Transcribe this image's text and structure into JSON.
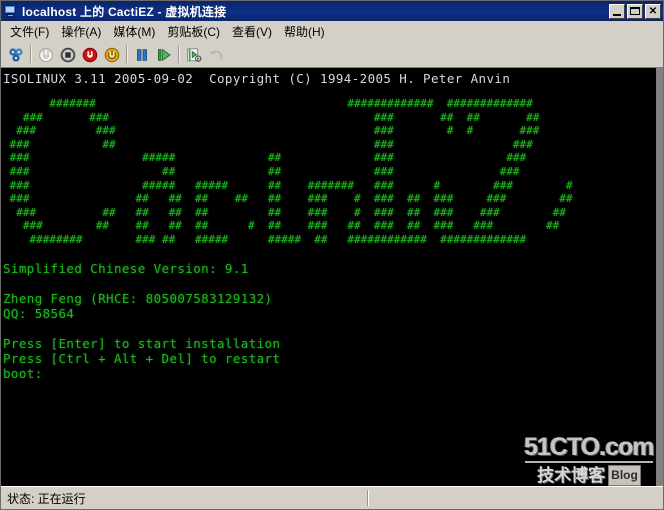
{
  "window": {
    "title": "localhost 上的 CactiEZ - 虚拟机连接",
    "title_icon": "computer-monitor-icon",
    "buttons": {
      "minimize": "minimize-button",
      "maximize": "maximize-button",
      "close": "✕"
    }
  },
  "menubar": {
    "items": [
      {
        "label": "文件(F)",
        "name": "menu-file"
      },
      {
        "label": "操作(A)",
        "name": "menu-action"
      },
      {
        "label": "媒体(M)",
        "name": "menu-media"
      },
      {
        "label": "剪贴板(C)",
        "name": "menu-clipboard"
      },
      {
        "label": "查看(V)",
        "name": "menu-view"
      },
      {
        "label": "帮助(H)",
        "name": "menu-help"
      }
    ]
  },
  "toolbar": {
    "buttons": [
      {
        "name": "ctrl-alt-delete-icon",
        "enabled": true
      },
      {
        "name": "power-off-icon",
        "enabled": false
      },
      {
        "name": "shut-down-icon",
        "enabled": true
      },
      {
        "name": "turn-off-icon",
        "enabled": true
      },
      {
        "name": "start-power-icon",
        "enabled": true
      },
      {
        "name": "pause-icon",
        "enabled": true
      },
      {
        "name": "resume-play-icon",
        "enabled": true
      },
      {
        "name": "snapshot-icon",
        "enabled": true
      },
      {
        "name": "revert-undo-icon",
        "enabled": false
      }
    ]
  },
  "terminal": {
    "header": "ISOLINUX 3.11 2005-09-02  Copyright (C) 1994-2005 H. Peter Anvin",
    "ascii_art": "       #######                                      #############  #############\n   ###       ###                                        ###       ##  ##       ##\n  ###         ###                                       ###        #  #       ###\n ###           ##                                       ###                  ###\n ###                 #####              ##              ###                 ###\n ###                    ##              ##              ###                ###\n ###                 #####   #####      ##    #######   ###      #        ###        #\n ###                ##   ##  ##    ##   ##    ###    #  ###  ##  ###     ###        ##\n  ###          ##   ##   ##  ##         ##    ###    #  ###  ##  ###    ###        ##\n   ###        ##    ##   ##  ##      #  ##    ###   ##  ###  ##  ###   ###        ##\n    ########        ### ##   #####      #####  ##   ############  #############",
    "messages": "Simplified Chinese Version: 9.1\n\nZheng Feng (RHCE: 805007583129132)\nQQ: 58564\n\nPress [Enter] to start installation\nPress [Ctrl + Alt + Del] to restart\nboot:",
    "colors": {
      "background": "#000000",
      "header_text": "#d9d9d9",
      "green": "#1eb81e"
    }
  },
  "watermark": {
    "top": "51CTO.com",
    "bottom": "技术博客",
    "badge": "Blog"
  },
  "statusbar": {
    "status": "状态: 正在运行",
    "extra": ""
  }
}
